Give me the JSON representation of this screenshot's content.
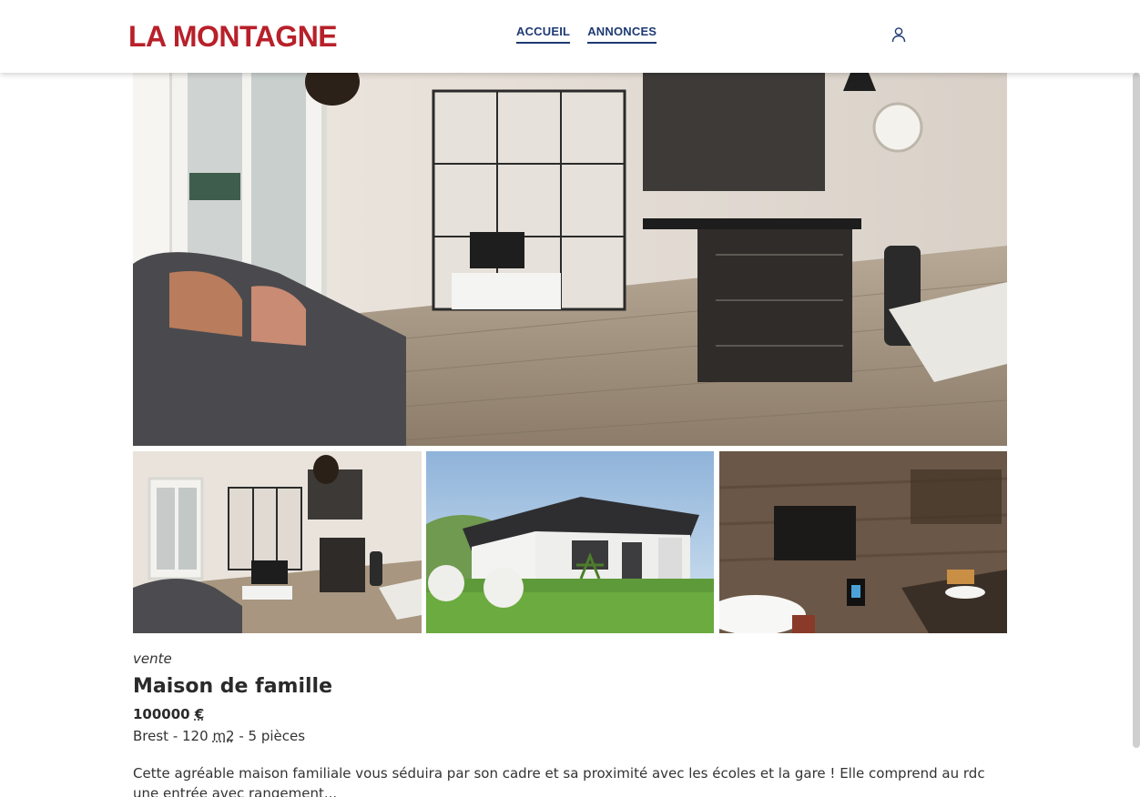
{
  "header": {
    "logo": "LA MONTAGNE",
    "nav": [
      {
        "label": "ACCUEIL"
      },
      {
        "label": "ANNONCES"
      }
    ],
    "user_icon": "user-icon"
  },
  "gallery": {
    "main_icon": "kitchen-living-room-photo",
    "thumbs": [
      "living-room-photo",
      "house-exterior-photo",
      "bathroom-photo"
    ]
  },
  "listing": {
    "type": "vente",
    "title": "Maison de famille",
    "price": "100000",
    "currency": "€",
    "city": "Brest",
    "sep1": " - ",
    "surface": "120",
    "surface_unit": "m2",
    "rooms": " - 5 pièces",
    "description": "Cette agréable maison familiale vous séduira par son cadre et sa proximité avec les écoles et la gare ! Elle comprend au rdc une entrée avec rangement..."
  },
  "colors": {
    "brand": "#b8202a",
    "nav": "#1e3a74"
  }
}
